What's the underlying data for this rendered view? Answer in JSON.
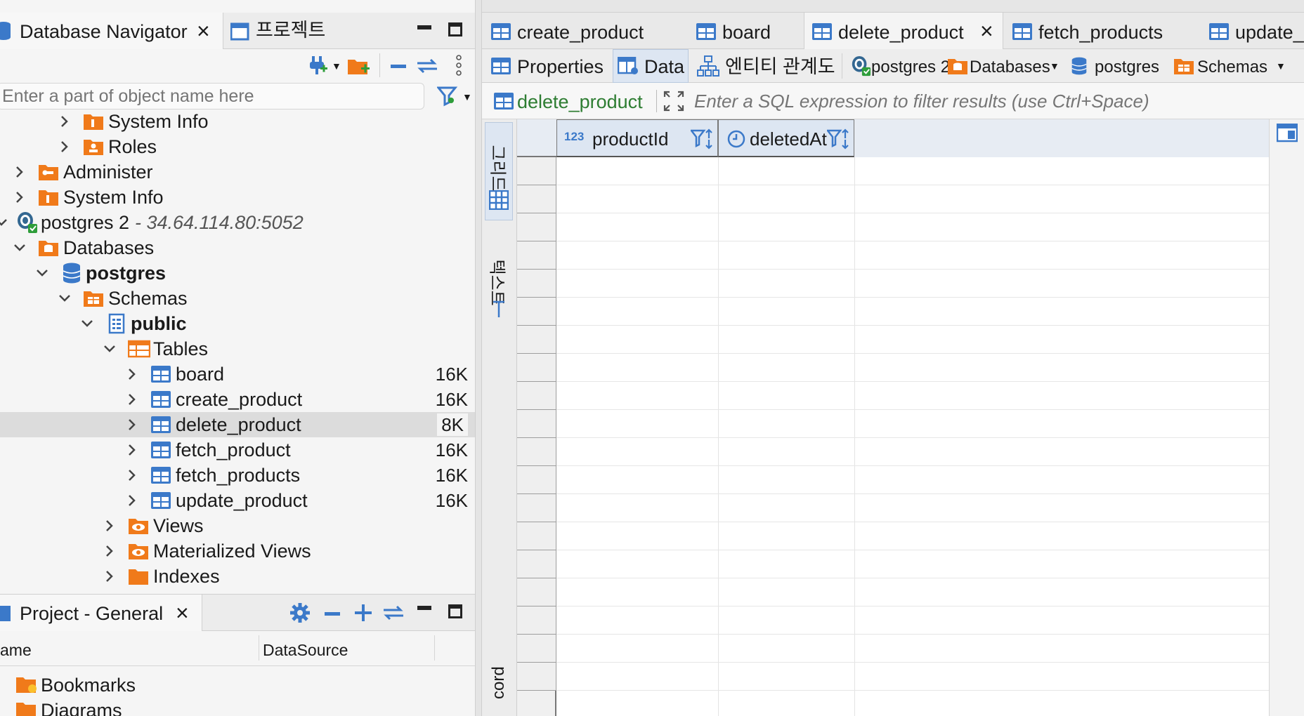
{
  "left": {
    "nav_tab": {
      "label": "Database Navigator",
      "close": "×"
    },
    "project_tab": {
      "label": "프로젝트"
    },
    "search": {
      "placeholder": "Enter a part of object name here"
    },
    "tree": [
      {
        "label": "System Info",
        "icon": "folder-info-icon",
        "chev": "right"
      },
      {
        "label": "Roles",
        "icon": "folder-roles-icon",
        "chev": "right"
      },
      {
        "label": "Administer",
        "icon": "folder-admin-icon",
        "chev": "right"
      },
      {
        "label": "System Info",
        "icon": "folder-info-icon",
        "chev": "right"
      },
      {
        "label": "postgres 2",
        "suffix": " - 34.64.114.80:5052",
        "icon": "postgres-connection-icon",
        "chev": "down"
      },
      {
        "label": "Databases",
        "icon": "folder-databases-icon",
        "chev": "down"
      },
      {
        "label": "postgres",
        "icon": "database-icon",
        "chev": "down",
        "bold": true
      },
      {
        "label": "Schemas",
        "icon": "folder-schemas-icon",
        "chev": "down"
      },
      {
        "label": "public",
        "icon": "schema-icon",
        "chev": "down",
        "bold": true
      },
      {
        "label": "Tables",
        "icon": "folder-tables-icon",
        "chev": "down"
      },
      {
        "label": "board",
        "icon": "table-icon",
        "chev": "right",
        "size": "16K"
      },
      {
        "label": "create_product",
        "icon": "table-icon",
        "chev": "right",
        "size": "16K"
      },
      {
        "label": "delete_product",
        "icon": "table-icon",
        "chev": "right",
        "size": "8K",
        "selected": true
      },
      {
        "label": "fetch_product",
        "icon": "table-icon",
        "chev": "right",
        "size": "16K"
      },
      {
        "label": "fetch_products",
        "icon": "table-icon",
        "chev": "right",
        "size": "16K"
      },
      {
        "label": "update_product",
        "icon": "table-icon",
        "chev": "right",
        "size": "16K"
      },
      {
        "label": "Views",
        "icon": "folder-views-icon",
        "chev": "right"
      },
      {
        "label": "Materialized Views",
        "icon": "folder-views-icon",
        "chev": "right"
      },
      {
        "label": "Indexes",
        "icon": "folder-indexes-icon",
        "chev": "right"
      }
    ],
    "project": {
      "tab_label": "Project - General",
      "close": "×",
      "col_name": "ame",
      "col_datasource": "DataSource",
      "items": [
        "Bookmarks",
        "Diagrams"
      ]
    }
  },
  "editor": {
    "tabs": [
      {
        "label": "create_product"
      },
      {
        "label": "board"
      },
      {
        "label": "delete_product",
        "active": true,
        "close": "×"
      },
      {
        "label": "fetch_products"
      },
      {
        "label": "update_"
      }
    ],
    "subtabs": {
      "properties": "Properties",
      "data": "Data",
      "er": "엔티티 관계도",
      "connection": "postgres 2",
      "databases": "Databases",
      "database": "postgres",
      "schemas": "Schemas"
    },
    "filter": {
      "table": "delete_product",
      "placeholder": "Enter a SQL expression to filter results (use Ctrl+Space)"
    },
    "side_tabs": {
      "grid": "그리드",
      "text": "텍스트",
      "record": "cord"
    },
    "columns": [
      {
        "name": "productId",
        "type_badge": "123"
      },
      {
        "name": "deletedAt"
      }
    ]
  },
  "colors": {
    "accent_blue": "#3b79c9",
    "folder_orange": "#f07a1a",
    "filter_green": "#2e7d32",
    "selection_gray": "#dcdcdc"
  }
}
